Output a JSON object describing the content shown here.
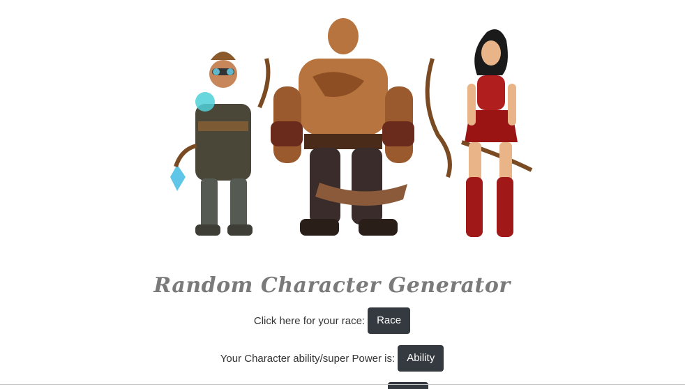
{
  "hero_image": {
    "icon": "fantasy-characters-illustration"
  },
  "title": "Random Character Generator",
  "race": {
    "prompt": "Click here for your race:",
    "button_label": "Race"
  },
  "ability": {
    "prompt": "Your Character ability/super Power is:",
    "button_label": "Ability"
  },
  "colors": {
    "button_bg": "#343a40",
    "title": "#7a7a7a"
  }
}
